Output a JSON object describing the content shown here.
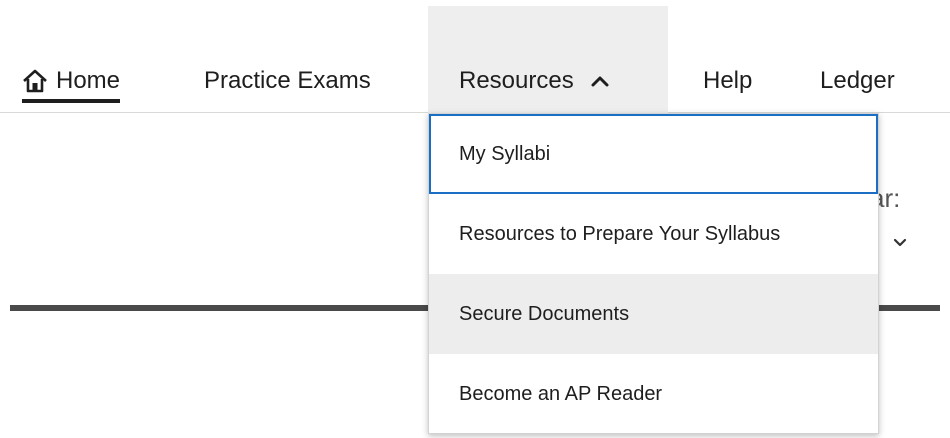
{
  "nav": {
    "items": [
      {
        "label": "Home",
        "icon": "home-icon",
        "active": true
      },
      {
        "label": "Practice Exams"
      },
      {
        "label": "Resources",
        "icon": "chevron-up-icon",
        "expanded": true
      },
      {
        "label": "Help"
      },
      {
        "label": "Ledger"
      }
    ]
  },
  "dropdown": {
    "items": [
      {
        "label": "My Syllabi",
        "state": "focused"
      },
      {
        "label": "Resources to Prepare Your Syllabus"
      },
      {
        "label": "Secure Documents",
        "state": "hovered"
      },
      {
        "label": "Become an AP Reader"
      }
    ]
  },
  "background": {
    "partial_text": "ar:",
    "icon": "chevron-down-icon"
  },
  "colors": {
    "text": "#1e1e1e",
    "focus_border": "#1a6fc4",
    "hover_bg": "#ededed",
    "nav_active_bg": "#eeeeee",
    "divider": "#4a4a4a"
  }
}
